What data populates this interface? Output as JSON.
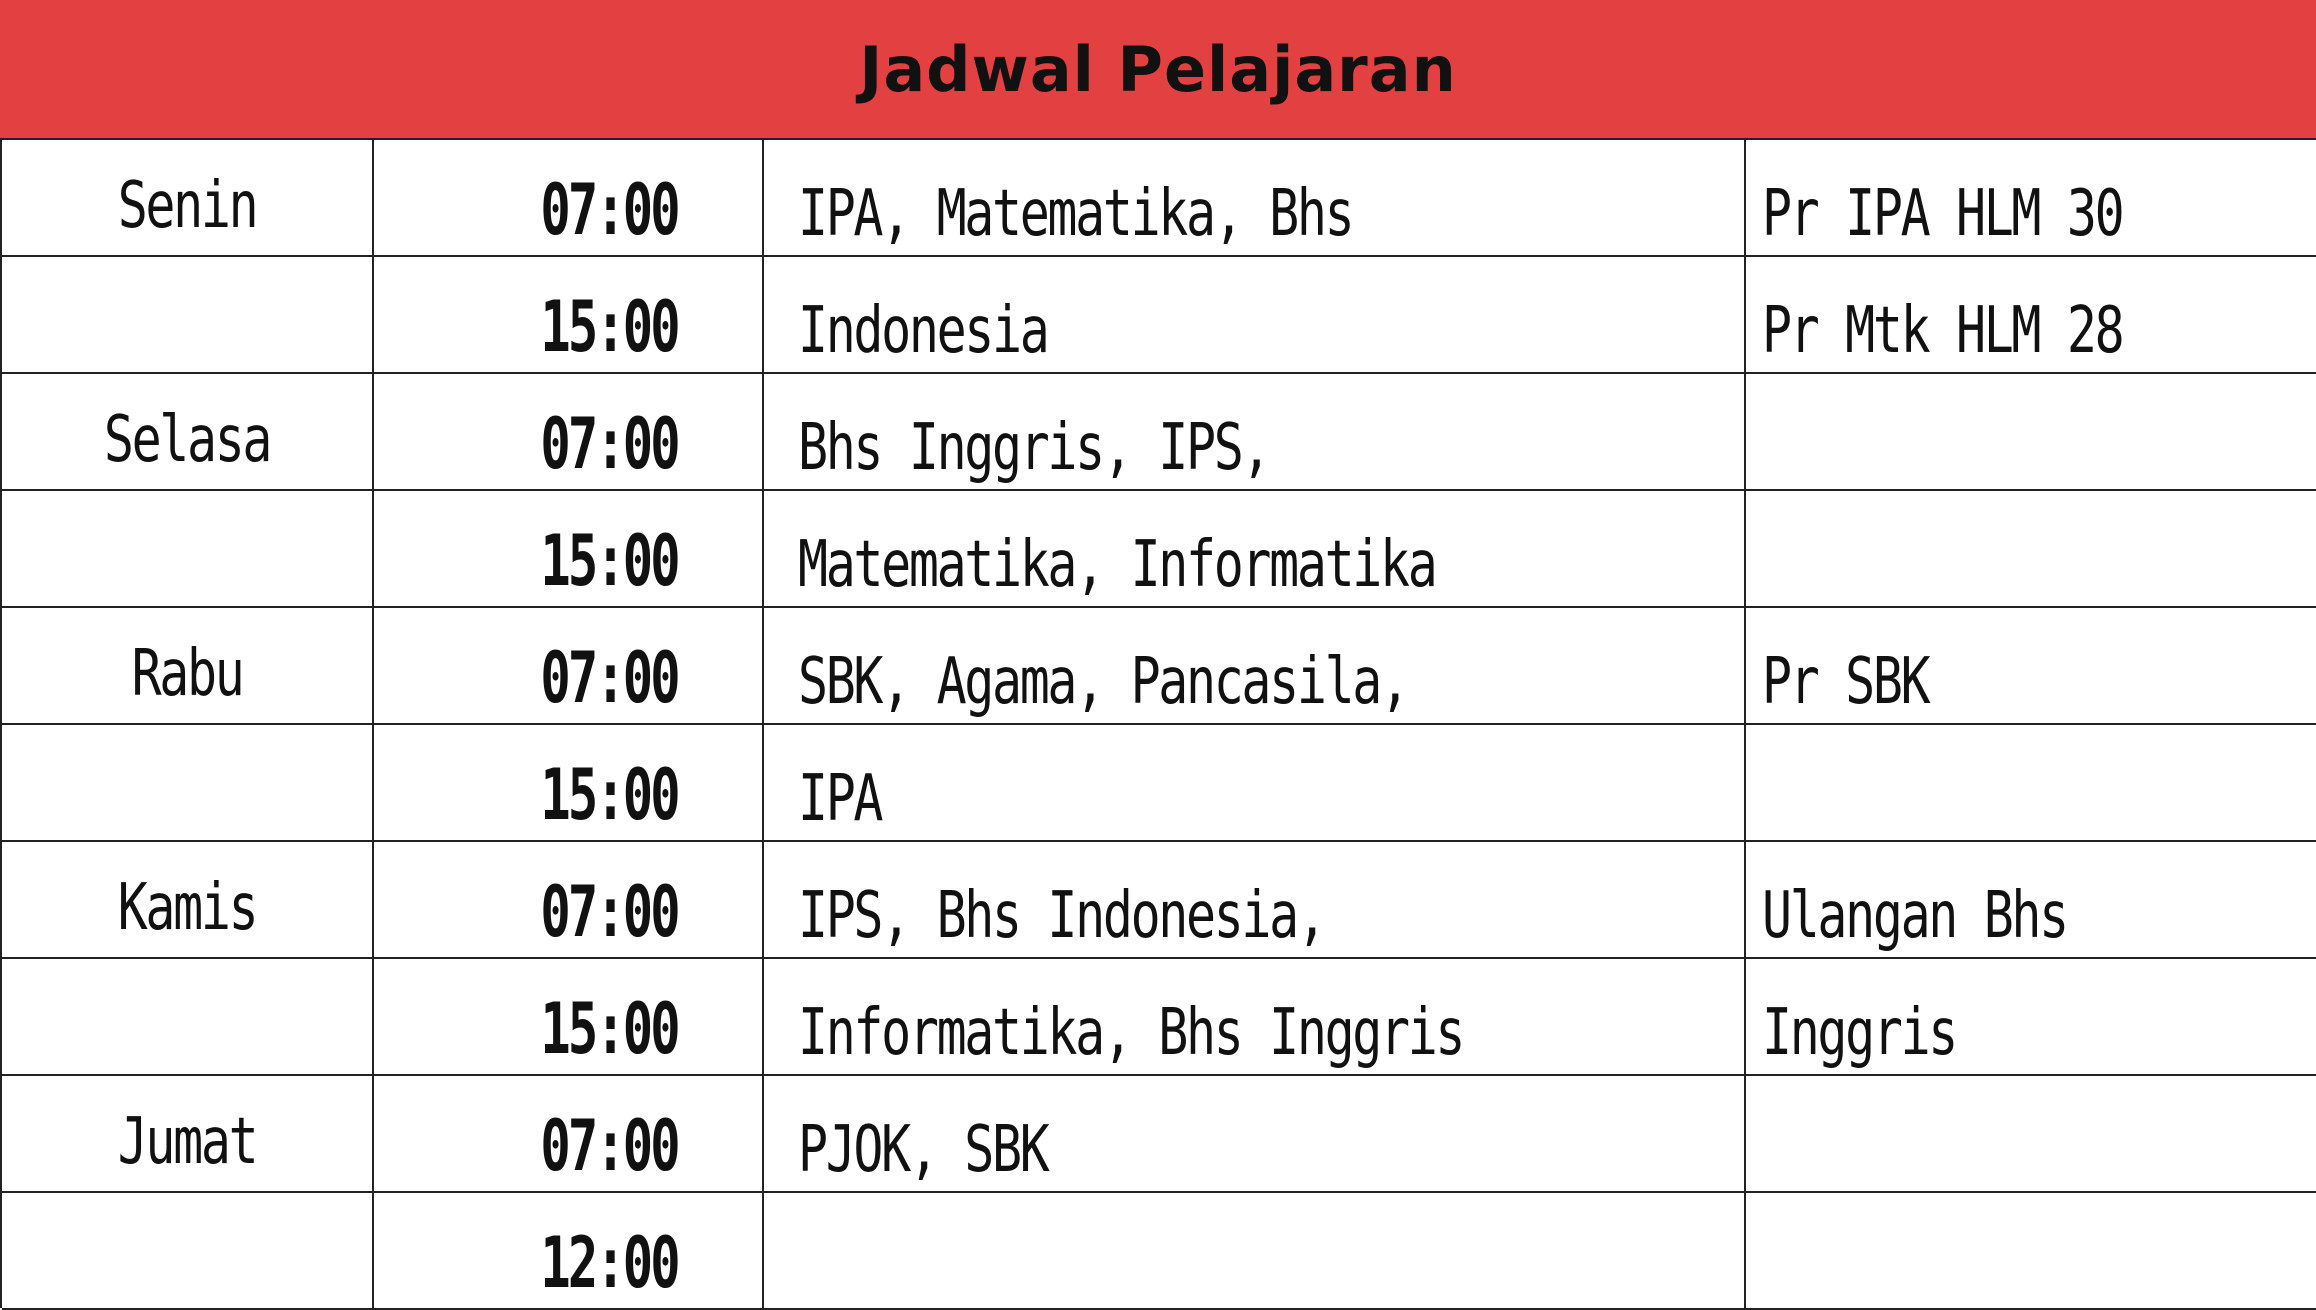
{
  "title": "Jadwal Pelajaran",
  "colors": {
    "header": "#e34141",
    "text": "#111111",
    "lines": "#222222"
  },
  "rows": [
    {
      "day": "Senin",
      "time": "07:00",
      "subject": "IPA, Matematika, Bhs",
      "note": "Pr IPA HLM 30"
    },
    {
      "day": "",
      "time": "15:00",
      "subject": "Indonesia",
      "note": "Pr Mtk HLM 28"
    },
    {
      "day": "Selasa",
      "time": "07:00",
      "subject": "Bhs Inggris, IPS,",
      "note": ""
    },
    {
      "day": "",
      "time": "15:00",
      "subject": "Matematika, Informatika",
      "note": ""
    },
    {
      "day": "Rabu",
      "time": "07:00",
      "subject": "SBK, Agama, Pancasila,",
      "note": "Pr SBK"
    },
    {
      "day": "",
      "time": "15:00",
      "subject": "IPA",
      "note": ""
    },
    {
      "day": "Kamis",
      "time": "07:00",
      "subject": "IPS, Bhs Indonesia,",
      "note": "Ulangan Bhs"
    },
    {
      "day": "",
      "time": "15:00",
      "subject": "Informatika, Bhs Inggris",
      "note": "Inggris"
    },
    {
      "day": "Jumat",
      "time": "07:00",
      "subject": "PJOK, SBK",
      "note": ""
    },
    {
      "day": "",
      "time": "12:00",
      "subject": "",
      "note": ""
    }
  ]
}
